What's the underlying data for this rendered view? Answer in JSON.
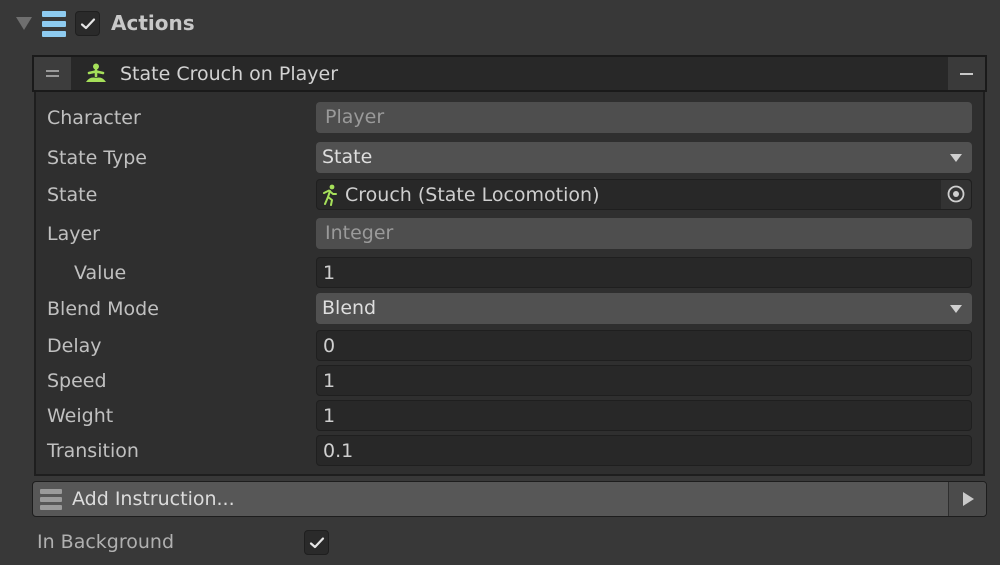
{
  "header": {
    "title": "Actions",
    "enabled": true,
    "icons": {
      "foldout": "foldout-expanded-icon",
      "list": "list-icon",
      "checkbox": "checkbox-checked-icon"
    }
  },
  "instruction": {
    "title": "State Crouch on Player",
    "icon": "meditate-icon",
    "accent_color": "#a6e05a",
    "remove_label": "−",
    "fields": [
      {
        "label": "Character",
        "value": "Player",
        "kind": "readonly"
      },
      {
        "label": "State Type",
        "value": "State",
        "kind": "dropdown"
      },
      {
        "label": "State",
        "value": "Crouch (State Locomotion)",
        "kind": "object",
        "icon": "running-person-icon"
      },
      {
        "label": "Layer",
        "value": "Integer",
        "kind": "readonly"
      },
      {
        "label": "Value",
        "value": "1",
        "kind": "input",
        "indented": true
      },
      {
        "label": "Blend Mode",
        "value": "Blend",
        "kind": "dropdown"
      },
      {
        "label": "Delay",
        "value": "0",
        "kind": "input"
      },
      {
        "label": "Speed",
        "value": "1",
        "kind": "input"
      },
      {
        "label": "Weight",
        "value": "1",
        "kind": "input"
      },
      {
        "label": "Transition",
        "value": "0.1",
        "kind": "input"
      }
    ]
  },
  "add_instruction": {
    "label": "Add Instruction..."
  },
  "in_background": {
    "label": "In Background",
    "checked": true
  }
}
